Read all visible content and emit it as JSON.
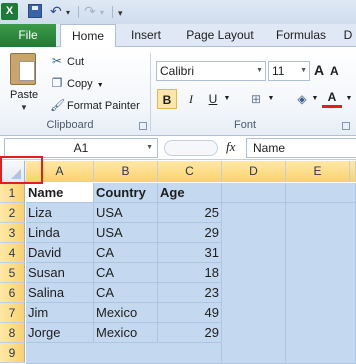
{
  "quick_access": {
    "app_logo_text": "X"
  },
  "tabs": {
    "file": "File",
    "items": [
      {
        "label": "Home"
      },
      {
        "label": "Insert"
      },
      {
        "label": "Page Layout"
      },
      {
        "label": "Formulas"
      },
      {
        "label": "D"
      }
    ],
    "active": "Home"
  },
  "ribbon": {
    "clipboard": {
      "paste": "Paste",
      "cut": "Cut",
      "copy": "Copy",
      "format_painter": "Format Painter",
      "group_label": "Clipboard"
    },
    "font": {
      "font_name": "Calibri",
      "font_size": "11",
      "grow": "A",
      "shrink": "A",
      "bold": "B",
      "italic": "I",
      "underline": "U",
      "font_color": "A",
      "group_label": "Font"
    }
  },
  "formula_bar": {
    "name_box": "A1",
    "fx": "fx",
    "content": "Name"
  },
  "grid": {
    "columns": [
      "A",
      "B",
      "C",
      "D",
      "E"
    ],
    "rows": [
      "1",
      "2",
      "3",
      "4",
      "5",
      "6",
      "7",
      "8",
      "9"
    ],
    "header": [
      "Name",
      "Country",
      "Age"
    ],
    "data": [
      [
        "Liza",
        "USA",
        "25"
      ],
      [
        "Linda",
        "USA",
        "29"
      ],
      [
        "David",
        "CA",
        "31"
      ],
      [
        "Susan",
        "CA",
        "18"
      ],
      [
        "Salina",
        "CA",
        "23"
      ],
      [
        "Jim",
        "Mexico",
        "49"
      ],
      [
        "Jorge",
        "Mexico",
        "29"
      ]
    ]
  },
  "colors": {
    "file_tab": "#217a33",
    "selection_fill": "#c4d8ef",
    "header_highlight": "#f9d26d",
    "annotation_box": "#e02020",
    "font_color_bar": "#e02020"
  }
}
